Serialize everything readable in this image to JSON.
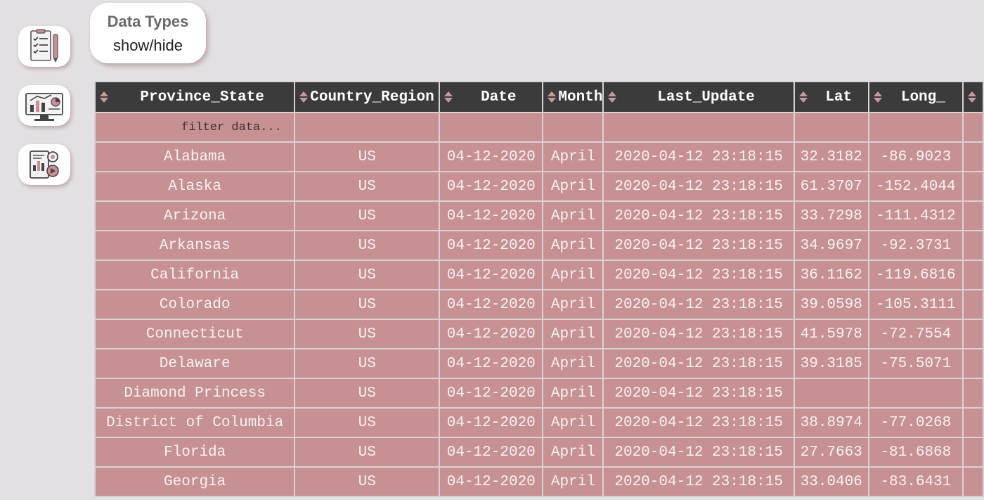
{
  "sidebar": {
    "buttons": [
      {
        "icon": "checklist-icon"
      },
      {
        "icon": "dashboard-chart-icon"
      },
      {
        "icon": "report-analytics-icon"
      }
    ]
  },
  "data_types_button": {
    "title": "Data Types",
    "subtitle": "show/hide"
  },
  "grid": {
    "columns": [
      "Province_State",
      "Country_Region",
      "Date",
      "Month",
      "Last_Update",
      "Lat",
      "Long_",
      ""
    ],
    "filter_placeholder": "filter data...",
    "rows": [
      [
        "Alabama",
        "US",
        "04-12-2020",
        "April",
        "2020-04-12 23:18:15",
        "32.3182",
        "-86.9023"
      ],
      [
        "Alaska",
        "US",
        "04-12-2020",
        "April",
        "2020-04-12 23:18:15",
        "61.3707",
        "-152.4044"
      ],
      [
        "Arizona",
        "US",
        "04-12-2020",
        "April",
        "2020-04-12 23:18:15",
        "33.7298",
        "-111.4312"
      ],
      [
        "Arkansas",
        "US",
        "04-12-2020",
        "April",
        "2020-04-12 23:18:15",
        "34.9697",
        "-92.3731"
      ],
      [
        "California",
        "US",
        "04-12-2020",
        "April",
        "2020-04-12 23:18:15",
        "36.1162",
        "-119.6816"
      ],
      [
        "Colorado",
        "US",
        "04-12-2020",
        "April",
        "2020-04-12 23:18:15",
        "39.0598",
        "-105.3111"
      ],
      [
        "Connecticut",
        "US",
        "04-12-2020",
        "April",
        "2020-04-12 23:18:15",
        "41.5978",
        "-72.7554"
      ],
      [
        "Delaware",
        "US",
        "04-12-2020",
        "April",
        "2020-04-12 23:18:15",
        "39.3185",
        "-75.5071"
      ],
      [
        "Diamond Princess",
        "US",
        "04-12-2020",
        "April",
        "2020-04-12 23:18:15",
        "",
        ""
      ],
      [
        "District of Columbia",
        "US",
        "04-12-2020",
        "April",
        "2020-04-12 23:18:15",
        "38.8974",
        "-77.0268"
      ],
      [
        "Florida",
        "US",
        "04-12-2020",
        "April",
        "2020-04-12 23:18:15",
        "27.7663",
        "-81.6868"
      ],
      [
        "Georgia",
        "US",
        "04-12-2020",
        "April",
        "2020-04-12 23:18:15",
        "33.0406",
        "-83.6431"
      ]
    ]
  },
  "colors": {
    "header_bg": "#3b3b3b",
    "cell_bg": "#c79093",
    "page_bg": "#e3e0e3"
  }
}
